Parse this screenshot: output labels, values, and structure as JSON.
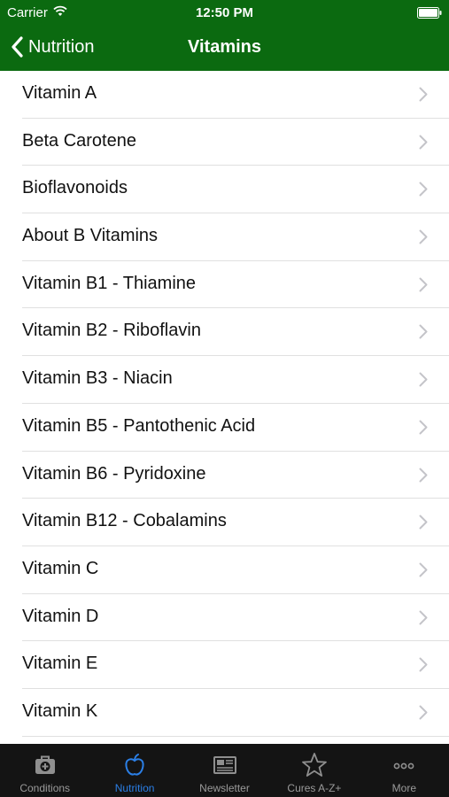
{
  "status_bar": {
    "carrier": "Carrier",
    "time": "12:50 PM"
  },
  "nav": {
    "back_label": "Nutrition",
    "title": "Vitamins"
  },
  "list": {
    "items": [
      {
        "label": "Vitamin A"
      },
      {
        "label": "Beta Carotene"
      },
      {
        "label": "Bioflavonoids"
      },
      {
        "label": "About B Vitamins"
      },
      {
        "label": "Vitamin B1 - Thiamine"
      },
      {
        "label": "Vitamin B2 - Riboflavin"
      },
      {
        "label": "Vitamin B3 - Niacin"
      },
      {
        "label": "Vitamin B5 - Pantothenic Acid"
      },
      {
        "label": "Vitamin B6 - Pyridoxine"
      },
      {
        "label": "Vitamin B12 - Cobalamins"
      },
      {
        "label": "Vitamin C"
      },
      {
        "label": "Vitamin D"
      },
      {
        "label": "Vitamin E"
      },
      {
        "label": "Vitamin K"
      }
    ]
  },
  "tab_bar": {
    "tabs": [
      {
        "label": "Conditions",
        "icon": "medical-kit-icon",
        "active": false
      },
      {
        "label": "Nutrition",
        "icon": "apple-icon",
        "active": true
      },
      {
        "label": "Newsletter",
        "icon": "newspaper-icon",
        "active": false
      },
      {
        "label": "Cures A-Z+",
        "icon": "star-icon",
        "active": false
      },
      {
        "label": "More",
        "icon": "more-dots-icon",
        "active": false
      }
    ]
  },
  "colors": {
    "header": "#0b6a10",
    "tab_bar": "#141414",
    "tab_active": "#2b7fe6",
    "tab_inactive": "#9a9a9a"
  }
}
